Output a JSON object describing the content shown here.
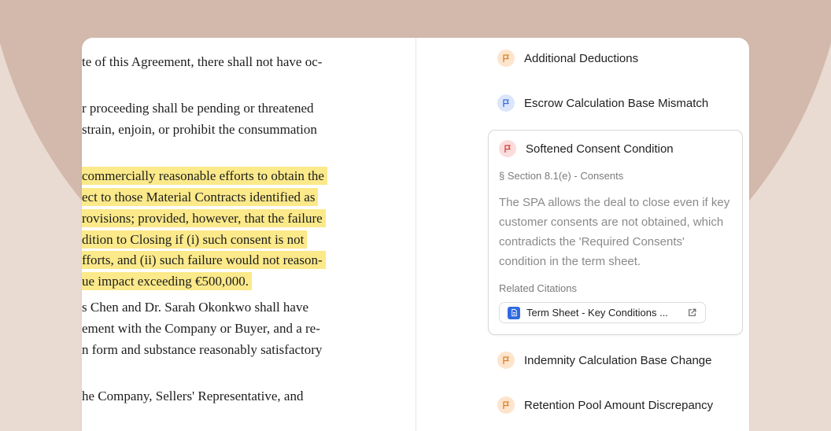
{
  "document": {
    "lines": [
      {
        "text": "te of this Agreement, there shall not have oc-",
        "highlight": false
      },
      {
        "text": "r proceeding shall be pending or threatened",
        "highlight": false
      },
      {
        "text": "strain, enjoin, or prohibit the consummation",
        "highlight": false
      },
      {
        "text": "commercially reasonable efforts to obtain the",
        "highlight": true
      },
      {
        "text": "ect to those Material Contracts identified as",
        "highlight": true
      },
      {
        "text": "rovisions; provided, however, that the failure",
        "highlight": true
      },
      {
        "text": "dition to Closing if (i) such consent is not",
        "highlight": true
      },
      {
        "text": "fforts, and (ii) such failure would not reason-",
        "highlight": true
      },
      {
        "text": "ue impact exceeding €500,000.",
        "highlight": true
      },
      {
        "text": "s Chen and Dr. Sarah Okonkwo shall have",
        "highlight": false
      },
      {
        "text": "ement with the Company or Buyer, and a re-",
        "highlight": false
      },
      {
        "text": "n form and substance reasonably satisfactory",
        "highlight": false
      },
      {
        "text": "he Company, Sellers' Representative, and",
        "highlight": false
      }
    ]
  },
  "issues": {
    "items": [
      {
        "title": "Additional Deductions",
        "status": "warning"
      },
      {
        "title": "Escrow Calculation Base Mismatch",
        "status": "info"
      },
      {
        "title": "Indemnity Calculation Base Change",
        "status": "warning"
      },
      {
        "title": "Retention Pool Amount Discrepancy",
        "status": "warning"
      }
    ],
    "expanded": {
      "title": "Softened Consent Condition",
      "status": "critical",
      "section": "§ Section 8.1(e) - Consents",
      "description": "The SPA allows the deal to close even if key customer consents are not obtained, which contradicts the 'Required Consents' condition in the term sheet.",
      "related_label": "Related Citations",
      "citation": {
        "label": "Term Sheet - Key Conditions ...",
        "icon": "document-icon",
        "action_icon": "external-link-icon"
      }
    }
  },
  "colors": {
    "highlight": "#fbe98a",
    "warning_flag_bg": "#fde4cc",
    "warning_flag": "#d9822b",
    "info_flag_bg": "#dbe6fb",
    "info_flag": "#3b6fd6",
    "critical_flag_bg": "#fbdcdc",
    "critical_flag": "#d0443d",
    "citation_icon": "#2f6ae0",
    "background": "#e9dbd2"
  }
}
